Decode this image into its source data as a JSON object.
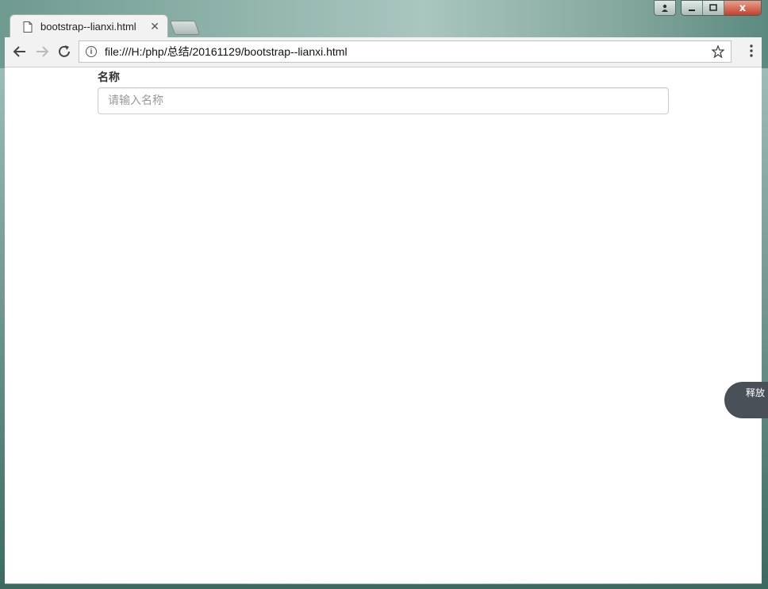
{
  "browser": {
    "tab": {
      "title": "bootstrap--lianxi.html",
      "close_glyph": "✕"
    },
    "address": {
      "url": "file:///H:/php/总结/20161129/bootstrap--lianxi.html"
    },
    "icons": {
      "back": "back-arrow-icon",
      "forward": "forward-arrow-icon",
      "reload": "reload-icon",
      "info": "info-icon",
      "star": "star-icon",
      "menu": "menu-dots-icon"
    },
    "caption": {
      "close_glyph": "x"
    }
  },
  "form": {
    "label": "名称",
    "input_placeholder": "请输入名称",
    "input_value": ""
  },
  "floating_button": {
    "label": "释放"
  },
  "colors": {
    "input_border": "#cccccc",
    "float_bg": "#4a5058",
    "close_red": "#c2412b"
  }
}
